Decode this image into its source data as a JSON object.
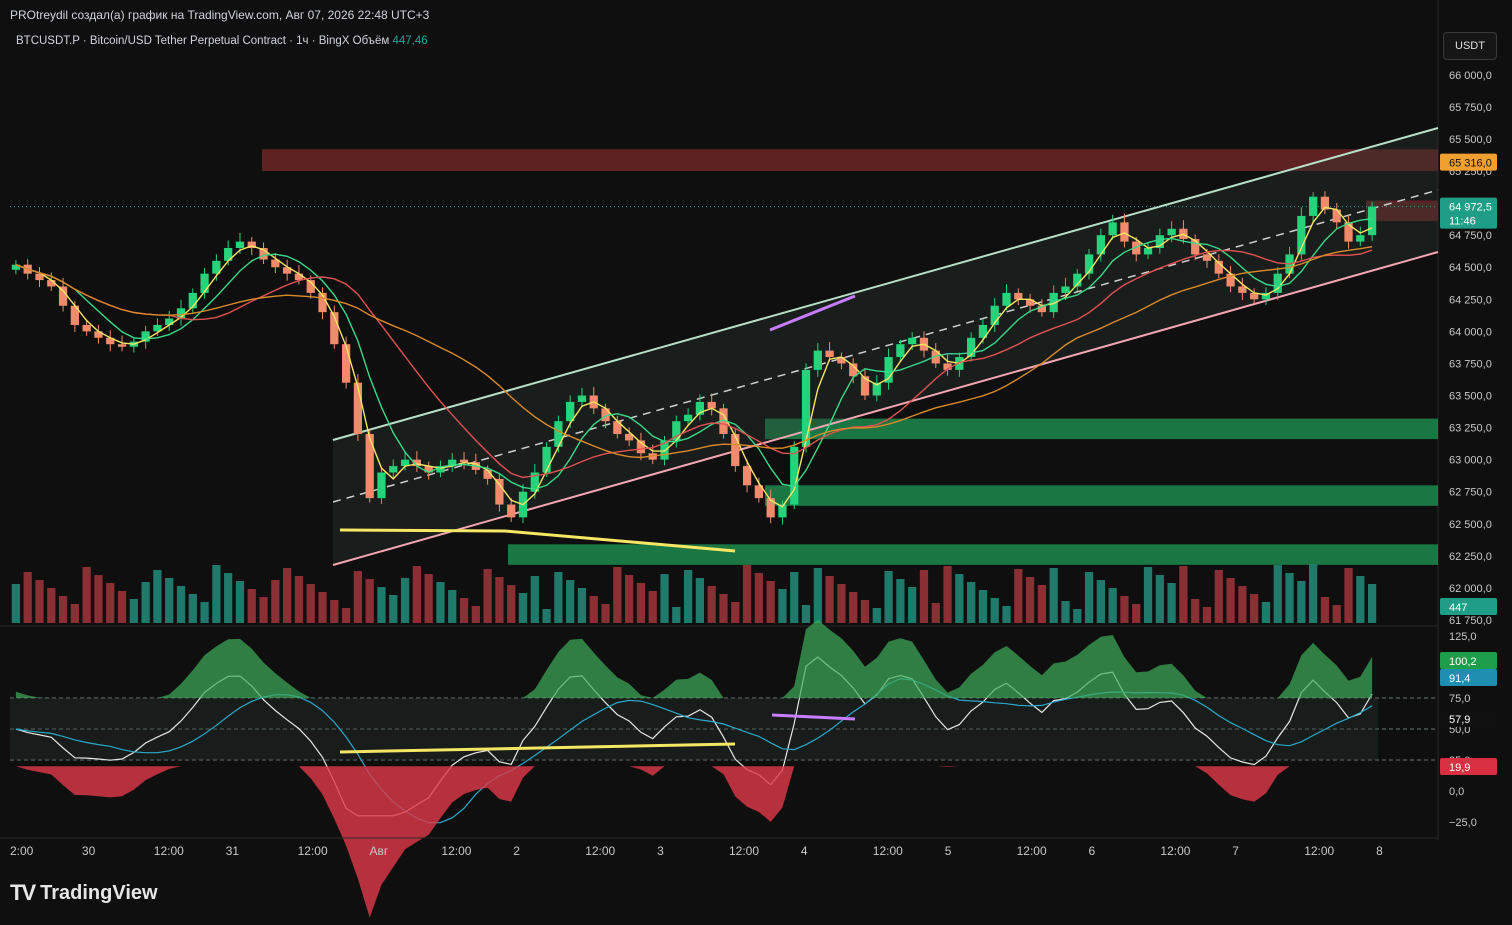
{
  "header": {
    "title": "PROtreydil создал(а) график на TradingView.com, Авг 07, 2026 22:48 UTC+3",
    "symbol_line": "BTCUSDT.P · Bitcoin/USD Tether Perpetual Contract · 1ч · BingX",
    "volume_label": "Объём",
    "volume_value": "447,46",
    "currency": "USDT"
  },
  "brand": {
    "name": "TradingView"
  },
  "colors": {
    "up": "#26d27a",
    "down": "#f28b6c",
    "resistance": "#7a2a2a",
    "support": "#1f9a55",
    "channel": "#b8e0c8",
    "rsi_fill_up": "#3fae5a",
    "rsi_fill_down": "#e03848",
    "accent_yellow": "#f5e663"
  },
  "price_axis": {
    "ticks": [
      "66 000,0",
      "65 750,0",
      "65 500,0",
      "65 250,0",
      "65 000,0",
      "64 750,0",
      "64 500,0",
      "64 250,0",
      "64 000,0",
      "63 750,0",
      "63 500,0",
      "63 250,0",
      "63 000,0",
      "62 750,0",
      "62 500,0",
      "62 250,0",
      "62 000,0",
      "61 750,0"
    ],
    "tag_level": "65 316,0",
    "tag_last": "64 972,5",
    "tag_timer": "11:46",
    "tag_volume": "447"
  },
  "indicator_axis": {
    "ticks": [
      "125,0",
      "75,0",
      "50,0",
      "25,0",
      "0,0",
      "−25,0"
    ],
    "tag_a": "100,2",
    "tag_b": "91,4",
    "tag_c": "57,9",
    "tag_d": "19,9"
  },
  "time_axis": {
    "ticks": [
      "2:00",
      "30",
      "12:00",
      "31",
      "12:00",
      "Авг",
      "12:00",
      "2",
      "12:00",
      "3",
      "12:00",
      "4",
      "12:00",
      "5",
      "12:00",
      "6",
      "12:00",
      "7",
      "12:00",
      "8"
    ]
  },
  "chart_data": {
    "type": "candlestick",
    "timeframe": "1h",
    "symbol": "BTCUSDT.P",
    "ylim": [
      61750,
      66100
    ],
    "current_price": 64972.5,
    "marked_level": 65316.0,
    "current_volume": 447.46,
    "resistance_zones": [
      {
        "from": 65250,
        "to": 65420
      },
      {
        "from": 64860,
        "to": 65020
      }
    ],
    "support_zones": [
      {
        "from": 63160,
        "to": 63320
      },
      {
        "from": 62640,
        "to": 62800
      },
      {
        "from": 62180,
        "to": 62340
      }
    ],
    "close_series": [
      64520,
      64450,
      64400,
      64350,
      64200,
      64050,
      64000,
      63950,
      63900,
      63880,
      63920,
      64000,
      64050,
      64100,
      64180,
      64300,
      64450,
      64550,
      64650,
      64700,
      64650,
      64560,
      64500,
      64450,
      64400,
      64300,
      64150,
      63900,
      63600,
      63200,
      62700,
      62900,
      62950,
      63000,
      62950,
      62900,
      62950,
      63000,
      62980,
      62920,
      62850,
      62650,
      62550,
      62750,
      62900,
      63100,
      63300,
      63450,
      63500,
      63400,
      63300,
      63200,
      63150,
      63050,
      63000,
      63150,
      63300,
      63350,
      63450,
      63400,
      63200,
      62950,
      62800,
      62700,
      62550,
      62650,
      63100,
      63700,
      63850,
      63800,
      63750,
      63650,
      63500,
      63600,
      63800,
      63900,
      63950,
      63850,
      63750,
      63700,
      63800,
      63950,
      64050,
      64200,
      64300,
      64250,
      64200,
      64150,
      64300,
      64350,
      64450,
      64600,
      64750,
      64850,
      64700,
      64600,
      64650,
      64750,
      64800,
      64720,
      64600,
      64550,
      64450,
      64350,
      64300,
      64250,
      64300,
      64450,
      64600,
      64900,
      65050,
      64950,
      64850,
      64700,
      64750,
      64972.5
    ],
    "rsi_ylim": [
      -25,
      125
    ],
    "rsi_levels": [
      75,
      50,
      25
    ]
  }
}
